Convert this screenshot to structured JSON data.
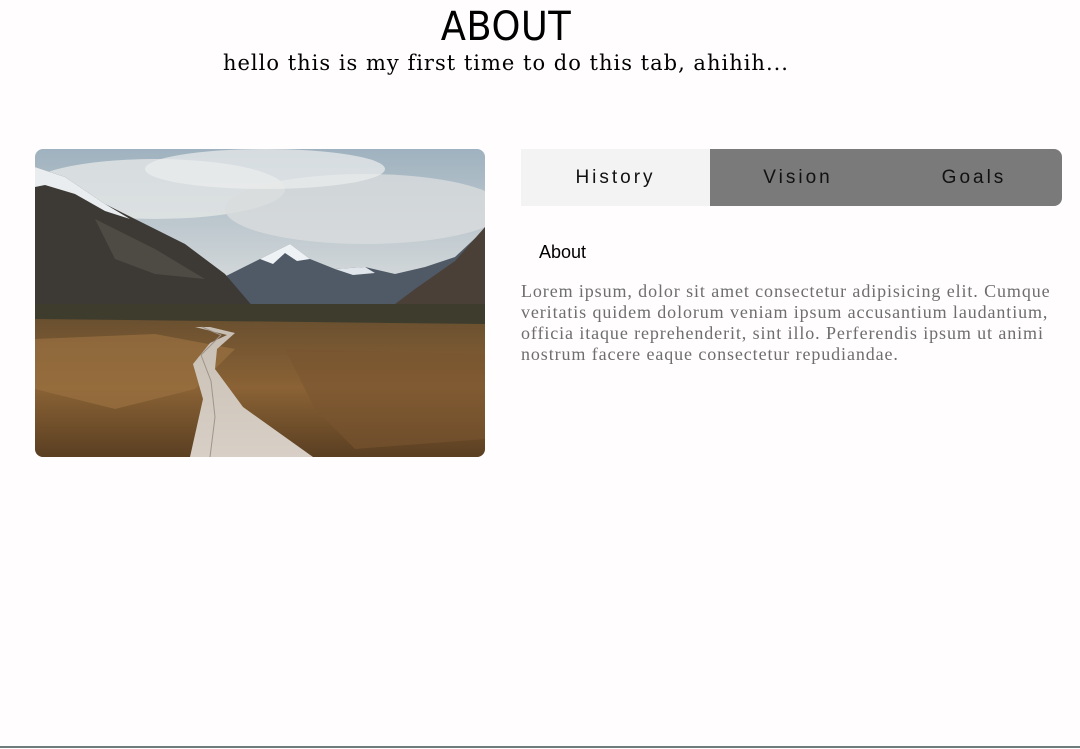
{
  "header": {
    "title": "ABOUT",
    "subtitle": "hello this is my first time to do this tab, ahihih..."
  },
  "tabs": [
    {
      "label": "History",
      "active": true
    },
    {
      "label": "Vision",
      "active": false
    },
    {
      "label": "Goals",
      "active": false
    }
  ],
  "panel": {
    "heading": "About",
    "text": "Lorem ipsum, dolor sit amet consectetur adipisicing elit. Cumque veritatis quidem dolorum veniam ipsum accusantium laudantium, officia itaque reprehenderit, sint illo. Perferendis ipsum ut animi nostrum facere eaque consectetur repudiandae."
  },
  "colors": {
    "active_tab_bg": "#f3f3f3",
    "tab_bar_bg": "#7a7a7a",
    "body_text": "#6e6e6e"
  }
}
